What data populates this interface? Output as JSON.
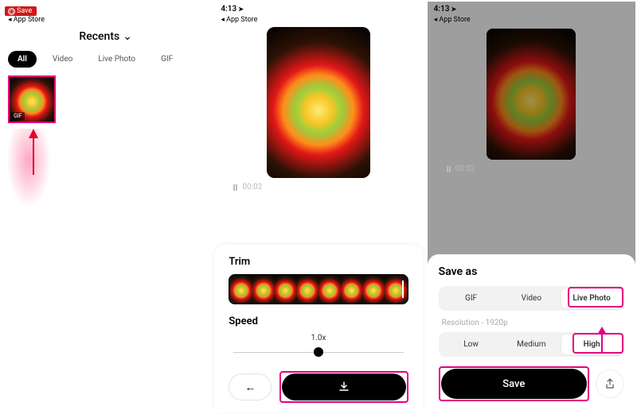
{
  "status": {
    "time": "4:13",
    "back_label": "App Store"
  },
  "save_badge": "Save",
  "screen1": {
    "title": "Recents",
    "tabs": [
      "All",
      "Video",
      "Live Photo",
      "GIF"
    ],
    "thumb_badge": "GIF"
  },
  "screen2": {
    "playback_time": "00:02",
    "trim_title": "Trim",
    "speed_title": "Speed",
    "speed_value": "1.0x"
  },
  "screen3": {
    "playback_time": "00:02",
    "sheet_title": "Save as",
    "formats": [
      "GIF",
      "Video",
      "Live Photo"
    ],
    "resolution_label": "Resolution - 1920p",
    "qualities": [
      "Low",
      "Medium",
      "High"
    ],
    "save_label": "Save"
  }
}
